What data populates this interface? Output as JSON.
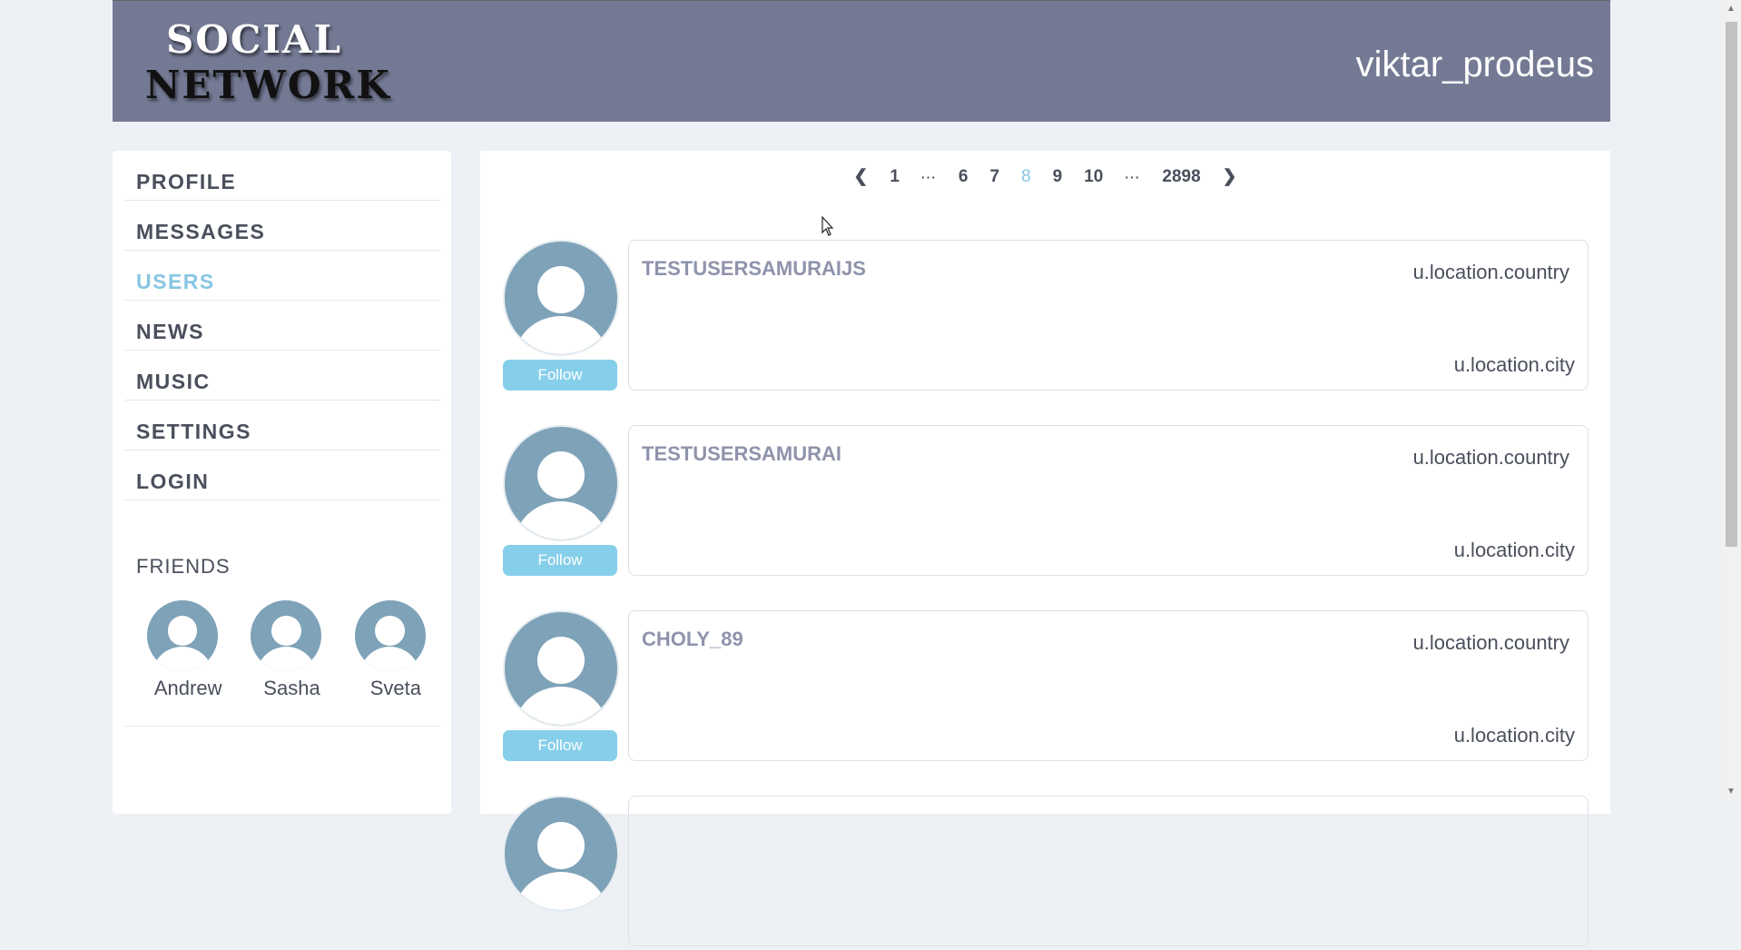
{
  "header": {
    "logo_line1": "SOCIAL",
    "logo_line2": "NETWORK",
    "username": "viktar_prodeus"
  },
  "sidebar": {
    "items": [
      {
        "label": "PROFILE"
      },
      {
        "label": "MESSAGES"
      },
      {
        "label": "USERS",
        "active": true
      },
      {
        "label": "NEWS"
      },
      {
        "label": "MUSIC"
      },
      {
        "label": "SETTINGS"
      },
      {
        "label": "LOGIN"
      }
    ],
    "friends_title": "FRIENDS",
    "friends": [
      {
        "name": "Andrew"
      },
      {
        "name": "Sasha"
      },
      {
        "name": "Sveta"
      }
    ]
  },
  "pagination": {
    "prev": "❮",
    "pages": [
      "1",
      "···",
      "6",
      "7",
      "8",
      "9",
      "10",
      "···",
      "2898"
    ],
    "current": "8",
    "next": "❯"
  },
  "users": [
    {
      "name": "TESTUSERSAMURAIJS",
      "country": "u.location.country",
      "city": "u.location.city",
      "follow_label": "Follow"
    },
    {
      "name": "TESTUSERSAMURAI",
      "country": "u.location.country",
      "city": "u.location.city",
      "follow_label": "Follow"
    },
    {
      "name": "CHOLY_89",
      "country": "u.location.country",
      "city": "u.location.city",
      "follow_label": "Follow"
    }
  ],
  "colors": {
    "header_bg": "#747a94",
    "accent": "#86c6e2",
    "follow_button": "#86cfeb",
    "avatar": "#7ea2b8"
  }
}
